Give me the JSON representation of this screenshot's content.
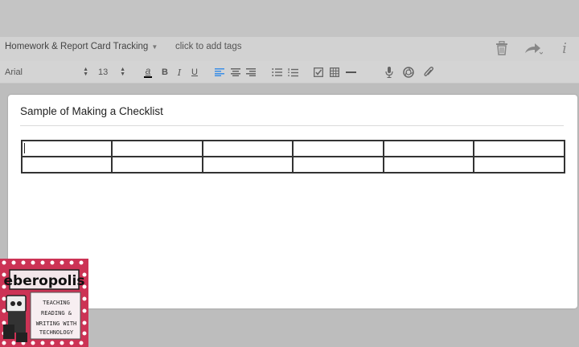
{
  "header": {
    "notebook": "Homework & Report Card Tracking",
    "tags_placeholder": "click to add tags",
    "icons": [
      "trash-icon",
      "share-icon",
      "info-icon"
    ]
  },
  "toolbar": {
    "font_name": "Arial",
    "font_size": "13",
    "text_color_label": "a",
    "bold_label": "B",
    "italic_label": "I",
    "underline_label": "U",
    "icons": [
      "align-left-icon",
      "align-center-icon",
      "align-right-icon",
      "bullet-list-icon",
      "numbered-list-icon",
      "checkbox-icon",
      "table-icon",
      "horizontal-rule-icon",
      "microphone-icon",
      "camera-icon",
      "paperclip-icon"
    ]
  },
  "note": {
    "title": "Sample of Making a Checklist",
    "table": {
      "rows": 2,
      "columns": 6
    }
  },
  "logo": {
    "name": "eberopolis",
    "tagline_lines": [
      "TEACHING",
      "READING &",
      "WRITING WITH",
      "TECHNOLOGY"
    ]
  },
  "colors": {
    "accent": "#3a8ee6",
    "logo_red": "#cc3355"
  }
}
